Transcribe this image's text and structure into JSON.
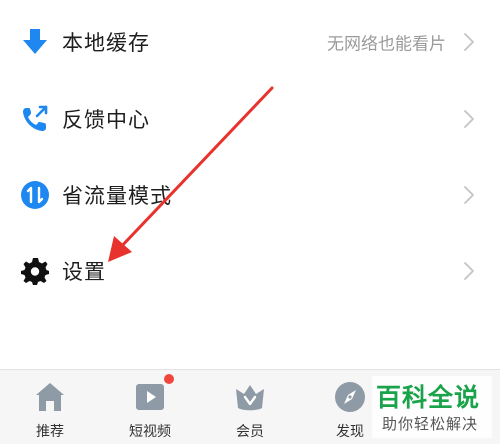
{
  "menu": {
    "items": [
      {
        "label": "本地缓存",
        "hint": "无网络也能看片",
        "icon": "download-arrow-icon",
        "color": "#1e88f0"
      },
      {
        "label": "反馈中心",
        "hint": "",
        "icon": "phone-feedback-icon",
        "color": "#1e88f0"
      },
      {
        "label": "省流量模式",
        "hint": "",
        "icon": "data-saver-icon",
        "color": "#1e88f0"
      },
      {
        "label": "设置",
        "hint": "",
        "icon": "gear-icon",
        "color": "#111111"
      }
    ]
  },
  "annotation": {
    "color": "#e8322d"
  },
  "tabbar": {
    "items": [
      {
        "label": "推荐",
        "icon": "home-icon"
      },
      {
        "label": "短视频",
        "icon": "video-play-icon",
        "badge": true
      },
      {
        "label": "会员",
        "icon": "crown-icon"
      },
      {
        "label": "发现",
        "icon": "compass-icon"
      }
    ]
  },
  "watermark": {
    "title": "百科全说",
    "subtitle": "助你轻松解决"
  }
}
